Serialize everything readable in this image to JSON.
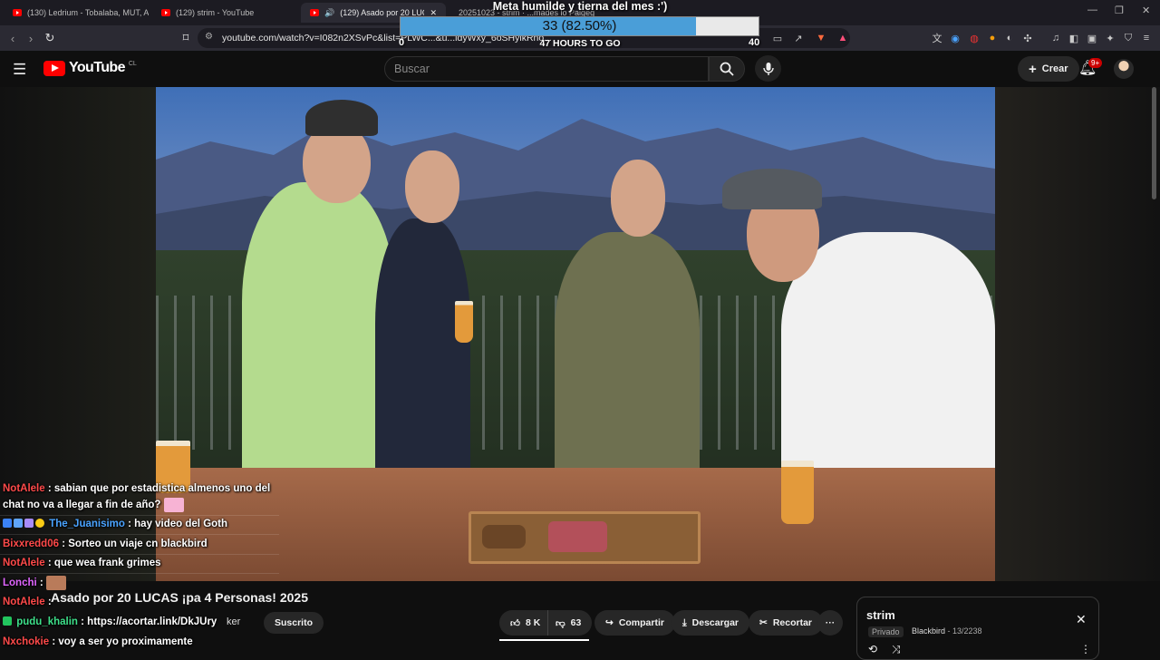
{
  "browser": {
    "tabs": [
      {
        "title": "(130) Ledrium - Tobalaba, MUT, Av. P",
        "active": false
      },
      {
        "title": "(129) strim - YouTube",
        "active": false
      },
      {
        "title": "(129) Asado por 20 LUCAS ¡pa",
        "active": true
      },
      {
        "title": "20251023 - strim · ...mades lo Paigeg",
        "active": false
      }
    ],
    "url": "youtube.com/watch?v=I082n2XSvPc&list=PLWC...&u...ldyWxy_6oSHylkRno...",
    "window_controls": [
      "—",
      "❐",
      "✕"
    ]
  },
  "goal": {
    "title": "Meta humilde y tierna del mes :')",
    "progress_text": "33 (82.50%)",
    "progress_fraction": 0.825,
    "min": "0",
    "max": "40",
    "time_left": "47 HOURS TO GO",
    "fill_color": "#4a9ed8"
  },
  "youtube": {
    "logo": "YouTube",
    "region": "CL",
    "search_placeholder": "Buscar",
    "create_label": "Crear",
    "notifications_badge": "9+",
    "icons": [
      "menu-icon",
      "search-icon",
      "mic-icon",
      "plus-icon",
      "bell-icon"
    ]
  },
  "chat": [
    {
      "user": "NotAlele",
      "color": "#ff4a4a",
      "text": ": sabian que por estadistica almenos uno del",
      "text2": "chat no va a llegar a fin de año?",
      "emote": "#f7b3d4"
    },
    {
      "user": "The_Juanisimo",
      "color": "#4aa3ff",
      "text": ": hay video del Goth",
      "badges": [
        "#3b82f6",
        "#60a5fa",
        "#a78bfa",
        "#facc15"
      ]
    },
    {
      "user": "Bixxredd06",
      "color": "#ff4a4a",
      "text": ": Sorteo un viaje cn blackbird"
    },
    {
      "user": "NotAlele",
      "color": "#ff4a4a",
      "text": ": que wea frank grimes"
    },
    {
      "user": "Lonchi",
      "color": "#e066ff",
      "text": ":",
      "emote": "#b97b5a"
    },
    {
      "user": "NotAlele",
      "color": "#ff4a4a",
      "text": ":"
    },
    {
      "user": "pudu_khalin",
      "color": "#3ee08a",
      "text": ": https://acortar.link/DkJUry",
      "badges": [
        "#22c55e"
      ]
    },
    {
      "user": "Nxchokie",
      "color": "#ff4a4a",
      "text": ": voy a ser yo proximamente"
    }
  ],
  "video": {
    "title": "Asado por 20 LUCAS ¡pa 4 Personas! 2025",
    "channel_fragment": "ker",
    "subscribe_label": "Suscrito",
    "likes": "8 K",
    "dislikes": "63",
    "share_label": "Compartir",
    "download_label": "Descargar",
    "clip_label": "Recortar",
    "more_label": "···"
  },
  "playlist": {
    "title": "strim",
    "privacy": "Privado",
    "channel": "Blackbird",
    "position": "13/2238"
  }
}
